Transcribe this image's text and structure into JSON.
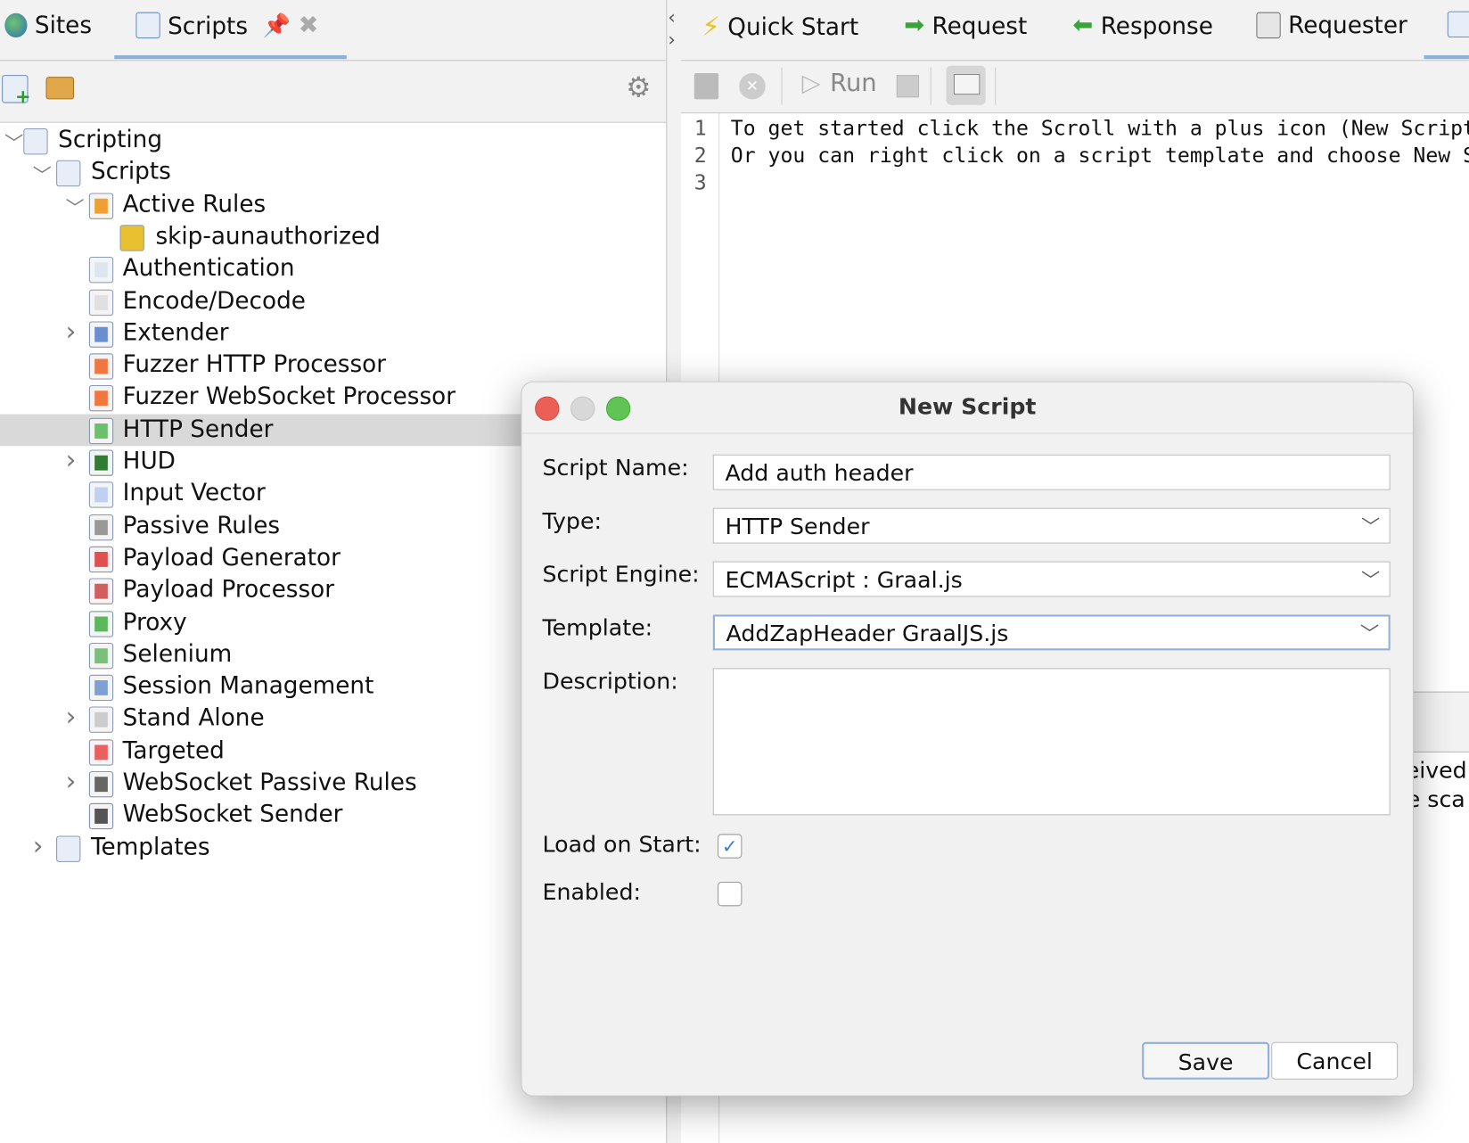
{
  "left_tabs": [
    {
      "label": "Sites",
      "icon": "globe-icon"
    },
    {
      "label": "Scripts",
      "icon": "scroll-icon",
      "active": true
    }
  ],
  "tree": [
    {
      "label": "Scripting",
      "level": 0,
      "chevron": "down"
    },
    {
      "label": "Scripts",
      "level": 1,
      "chevron": "down"
    },
    {
      "label": "Active Rules",
      "level": 2,
      "chevron": "down"
    },
    {
      "label": "skip-aunauthorized",
      "level": 3,
      "chevron": ""
    },
    {
      "label": "Authentication",
      "level": 2,
      "chevron": ""
    },
    {
      "label": "Encode/Decode",
      "level": 2,
      "chevron": ""
    },
    {
      "label": "Extender",
      "level": 2,
      "chevron": "right"
    },
    {
      "label": "Fuzzer HTTP Processor",
      "level": 2,
      "chevron": ""
    },
    {
      "label": "Fuzzer WebSocket Processor",
      "level": 2,
      "chevron": ""
    },
    {
      "label": "HTTP Sender",
      "level": 2,
      "chevron": "",
      "selected": true
    },
    {
      "label": "HUD",
      "level": 2,
      "chevron": "right"
    },
    {
      "label": "Input Vector",
      "level": 2,
      "chevron": ""
    },
    {
      "label": "Passive Rules",
      "level": 2,
      "chevron": ""
    },
    {
      "label": "Payload Generator",
      "level": 2,
      "chevron": ""
    },
    {
      "label": "Payload Processor",
      "level": 2,
      "chevron": ""
    },
    {
      "label": "Proxy",
      "level": 2,
      "chevron": ""
    },
    {
      "label": "Selenium",
      "level": 2,
      "chevron": ""
    },
    {
      "label": "Session Management",
      "level": 2,
      "chevron": ""
    },
    {
      "label": "Stand Alone",
      "level": 2,
      "chevron": "right"
    },
    {
      "label": "Targeted",
      "level": 2,
      "chevron": ""
    },
    {
      "label": "WebSocket Passive Rules",
      "level": 2,
      "chevron": "right"
    },
    {
      "label": "WebSocket Sender",
      "level": 2,
      "chevron": ""
    },
    {
      "label": "Templates",
      "level": 1,
      "chevron": "right"
    }
  ],
  "right_tabs": [
    {
      "label": "Quick Start",
      "icon": "lightning-icon"
    },
    {
      "label": "Request",
      "icon": "arrow-right-icon"
    },
    {
      "label": "Response",
      "icon": "arrow-left-icon"
    },
    {
      "label": "Requester",
      "icon": "windows-icon"
    }
  ],
  "toolbar": {
    "run_label": "Run"
  },
  "editor": {
    "lines": [
      "To get started click the Scroll with a plus icon (New Script",
      "Or you can right click on a script template and choose New S",
      ""
    ]
  },
  "background_text": [
    "ceived",
    "ve sca"
  ],
  "dialog": {
    "title": "New Script",
    "script_name_label": "Script Name:",
    "script_name": "Add auth header",
    "type_label": "Type:",
    "type": "HTTP Sender",
    "engine_label": "Script Engine:",
    "engine": "ECMAScript : Graal.js",
    "template_label": "Template:",
    "template": "AddZapHeader GraalJS.js",
    "description_label": "Description:",
    "description": "",
    "load_on_start_label": "Load on Start:",
    "load_on_start": true,
    "enabled_label": "Enabled:",
    "enabled": false,
    "save_label": "Save",
    "cancel_label": "Cancel"
  },
  "colors": {
    "accent": "#8fb0dc",
    "selected_row": "#d9d9d9"
  }
}
